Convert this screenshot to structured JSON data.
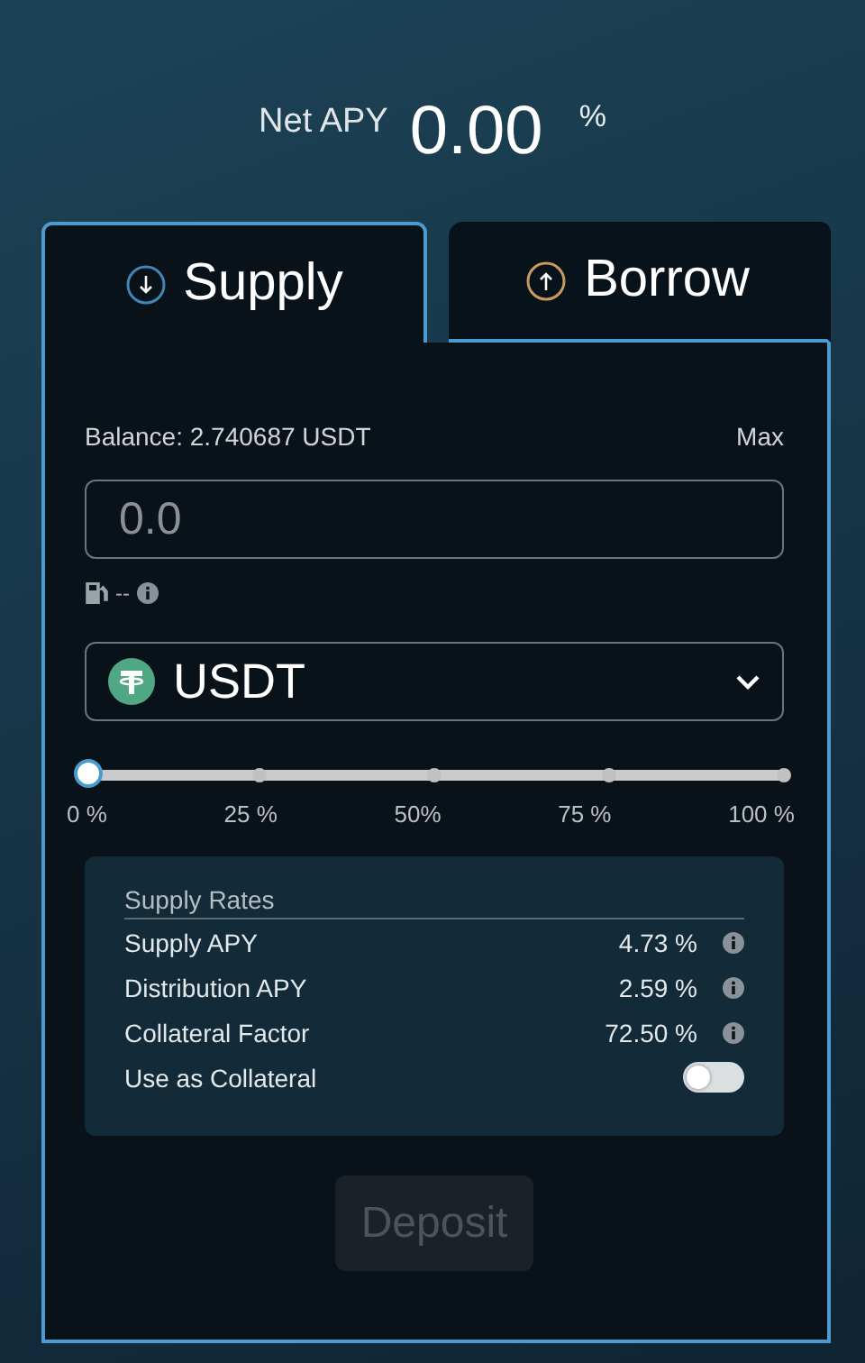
{
  "net_apy": {
    "label": "Net APY",
    "value": "0.00",
    "unit": "%"
  },
  "tabs": [
    {
      "label": "Supply",
      "kind": "supply",
      "selected": true
    },
    {
      "label": "Borrow",
      "kind": "borrow",
      "selected": false
    }
  ],
  "balance": {
    "label": "Balance: 2.740687 USDT",
    "max": "Max"
  },
  "amount": {
    "placeholder": "0.0"
  },
  "gas": {
    "value": "--"
  },
  "asset": {
    "symbol": "USDT"
  },
  "slider": {
    "level": 0,
    "marks": [
      "0 %",
      "25 %",
      "50%",
      "75 %",
      "100 %"
    ]
  },
  "rates": {
    "title": "Supply Rates",
    "rows": [
      {
        "kind": "value",
        "label": "Supply APY",
        "value": "4.73 %"
      },
      {
        "kind": "value",
        "label": "Distribution APY",
        "value": "2.59 %"
      },
      {
        "kind": "value",
        "label": "Collateral Factor",
        "value": "72.50 %"
      },
      {
        "kind": "toggle",
        "label": "Use as Collateral",
        "on": false
      }
    ]
  },
  "deposit": {
    "label": "Deposit",
    "disabled": true
  }
}
